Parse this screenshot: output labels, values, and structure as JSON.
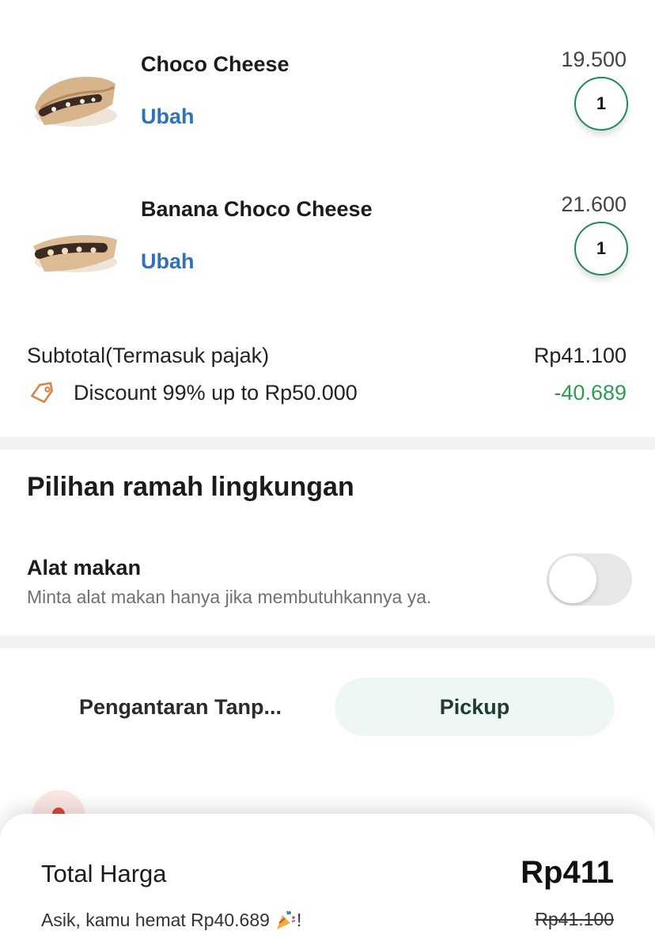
{
  "cart": {
    "items": [
      {
        "name": "Choco Cheese",
        "edit_label": "Ubah",
        "price": "19.500",
        "quantity": "1"
      },
      {
        "name": "Banana Choco Cheese",
        "edit_label": "Ubah",
        "price": "21.600",
        "quantity": "1"
      }
    ]
  },
  "summary": {
    "subtotal_label": "Subtotal(Termasuk pajak)",
    "subtotal_value": "Rp41.100",
    "discount_label": "Discount 99% up to Rp50.000",
    "discount_value": "-40.689",
    "discount_color": "#2e9b55"
  },
  "eco": {
    "title": "Pilihan ramah lingkungan",
    "cutlery_label": "Alat makan",
    "cutlery_hint": "Minta alat makan hanya jika membutuhkannya ya.",
    "cutlery_enabled": false
  },
  "delivery_mode": {
    "tabs": [
      {
        "label": "Pengantaran Tanp...",
        "active": false
      },
      {
        "label": "Pickup",
        "active": true
      }
    ]
  },
  "total": {
    "label": "Total Harga",
    "amount": "Rp411",
    "savings_text": "Asik, kamu hemat Rp40.689",
    "savings_suffix": "!",
    "original_amount": "Rp41.100"
  },
  "colors": {
    "accent_green": "#1f8a55",
    "link_blue": "#2f72b8",
    "discount_green": "#2e9b55",
    "tag_orange": "#d9854a"
  }
}
